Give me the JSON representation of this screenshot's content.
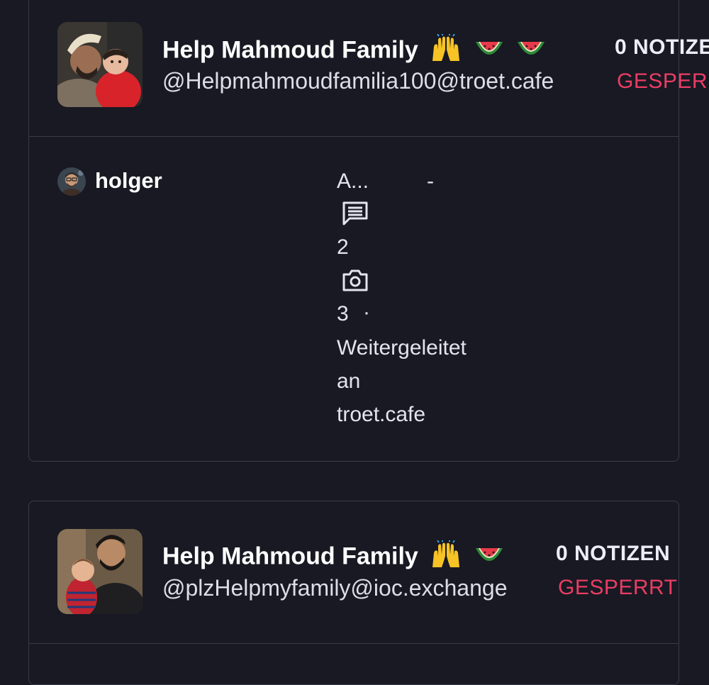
{
  "entries": [
    {
      "display_name": "Help Mahmoud Family",
      "emojis": [
        "raising-hands",
        "watermelon",
        "watermelon"
      ],
      "handle": "@Helpmahmoudfamilia100@troet.cafe",
      "notes": "0 NOTIZE",
      "status": "GESPERR",
      "moderation": {
        "moderator": "holger",
        "comment_preview": "A...",
        "dash": "-",
        "comments_count": "2",
        "media_count": "3",
        "separator": "·",
        "forwarded_lines": [
          "Weitergeleitet",
          "an",
          "troet.cafe"
        ]
      }
    },
    {
      "display_name": "Help Mahmoud Family",
      "emojis": [
        "raising-hands",
        "watermelon"
      ],
      "handle": "@plzHelpmyfamily@ioc.exchange",
      "notes": "0 NOTIZEN",
      "status": "GESPERRT"
    }
  ],
  "icons": {
    "comments": "chat-bubble-lines-icon",
    "media": "camera-icon"
  },
  "colors": {
    "background": "#181922",
    "border": "#393b4a",
    "status_red": "#ea3d64"
  }
}
